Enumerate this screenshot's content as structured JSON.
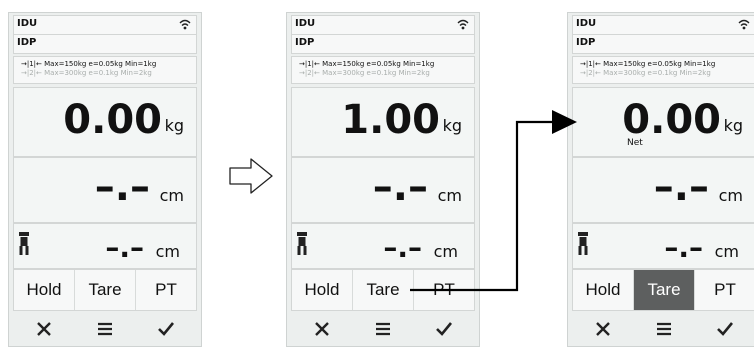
{
  "colors": {
    "screen_bg": "#ecefee",
    "panel_bg": "#f3f6f5",
    "active_button_bg": "#5d5f5f",
    "text": "#111111"
  },
  "screens": [
    {
      "header_line1": "IDU",
      "header_line2": "IDP",
      "scale_range1": "→|1|← Max=150kg e=0.05kg Min=1kg",
      "scale_range2": "→|2|← Max=300kg e=0.1kg Min=2kg",
      "weight_value": "0.00",
      "weight_unit": "kg",
      "net_label": "",
      "height_value": "–.–",
      "height_unit": "cm",
      "arm_value": "–.–",
      "arm_unit": "cm",
      "buttons": [
        "Hold",
        "Tare",
        "PT"
      ],
      "active_button": "",
      "actions": [
        "cancel-icon",
        "menu-icon",
        "confirm-icon"
      ]
    },
    {
      "header_line1": "IDU",
      "header_line2": "IDP",
      "scale_range1": "→|1|← Max=150kg e=0.05kg Min=1kg",
      "scale_range2": "→|2|← Max=300kg e=0.1kg Min=2kg",
      "weight_value": "1.00",
      "weight_unit": "kg",
      "net_label": "",
      "height_value": "–.–",
      "height_unit": "cm",
      "arm_value": "–.–",
      "arm_unit": "cm",
      "buttons": [
        "Hold",
        "Tare",
        "PT"
      ],
      "active_button": "",
      "actions": [
        "cancel-icon",
        "menu-icon",
        "confirm-icon"
      ]
    },
    {
      "header_line1": "IDU",
      "header_line2": "IDP",
      "scale_range1": "→|1|← Max=150kg e=0.05kg Min=1kg",
      "scale_range2": "→|2|← Max=300kg e=0.1kg Min=2kg",
      "weight_value": "0.00",
      "weight_unit": "kg",
      "net_label": "Net",
      "height_value": "–.–",
      "height_unit": "cm",
      "arm_value": "–.–",
      "arm_unit": "cm",
      "buttons": [
        "Hold",
        "Tare",
        "PT"
      ],
      "active_button": "Tare",
      "actions": [
        "cancel-icon",
        "menu-icon",
        "confirm-icon"
      ]
    }
  ]
}
